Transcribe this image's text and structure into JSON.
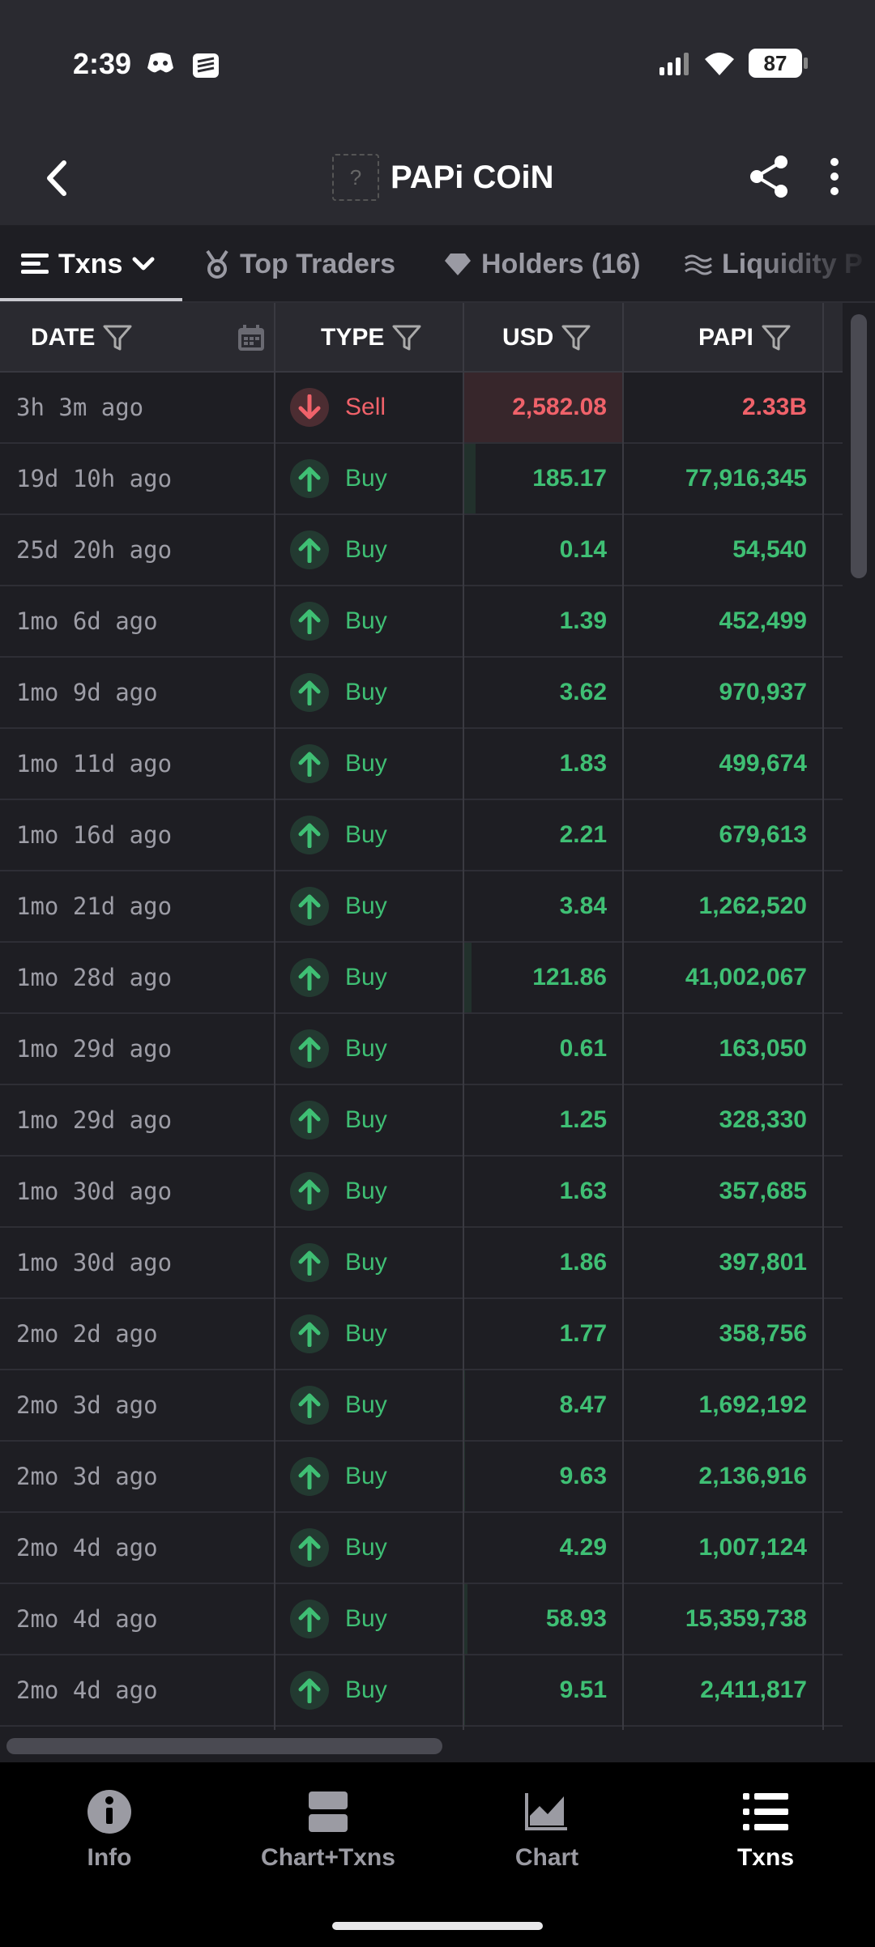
{
  "status_bar": {
    "time": "2:39",
    "battery": "87"
  },
  "header": {
    "title": "PAPi COiN",
    "logo_placeholder": "?"
  },
  "tabs": [
    {
      "label": "Txns",
      "active": true
    },
    {
      "label": "Top Traders"
    },
    {
      "label": "Holders (16)"
    },
    {
      "label": "Liquidity P"
    }
  ],
  "table": {
    "columns": {
      "date": "DATE",
      "type": "TYPE",
      "usd": "USD",
      "papi": "PAPI"
    },
    "rows": [
      {
        "date": "3h 3m ago",
        "type": "Sell",
        "usd": "2,582.08",
        "papi": "2.33B"
      },
      {
        "date": "19d 10h ago",
        "type": "Buy",
        "usd": "185.17",
        "papi": "77,916,345"
      },
      {
        "date": "25d 20h ago",
        "type": "Buy",
        "usd": "0.14",
        "papi": "54,540"
      },
      {
        "date": "1mo 6d ago",
        "type": "Buy",
        "usd": "1.39",
        "papi": "452,499"
      },
      {
        "date": "1mo 9d ago",
        "type": "Buy",
        "usd": "3.62",
        "papi": "970,937"
      },
      {
        "date": "1mo 11d ago",
        "type": "Buy",
        "usd": "1.83",
        "papi": "499,674"
      },
      {
        "date": "1mo 16d ago",
        "type": "Buy",
        "usd": "2.21",
        "papi": "679,613"
      },
      {
        "date": "1mo 21d ago",
        "type": "Buy",
        "usd": "3.84",
        "papi": "1,262,520"
      },
      {
        "date": "1mo 28d ago",
        "type": "Buy",
        "usd": "121.86",
        "papi": "41,002,067"
      },
      {
        "date": "1mo 29d ago",
        "type": "Buy",
        "usd": "0.61",
        "papi": "163,050"
      },
      {
        "date": "1mo 29d ago",
        "type": "Buy",
        "usd": "1.25",
        "papi": "328,330"
      },
      {
        "date": "1mo 30d ago",
        "type": "Buy",
        "usd": "1.63",
        "papi": "357,685"
      },
      {
        "date": "1mo 30d ago",
        "type": "Buy",
        "usd": "1.86",
        "papi": "397,801"
      },
      {
        "date": "2mo 2d ago",
        "type": "Buy",
        "usd": "1.77",
        "papi": "358,756"
      },
      {
        "date": "2mo 3d ago",
        "type": "Buy",
        "usd": "8.47",
        "papi": "1,692,192"
      },
      {
        "date": "2mo 3d ago",
        "type": "Buy",
        "usd": "9.63",
        "papi": "2,136,916"
      },
      {
        "date": "2mo 4d ago",
        "type": "Buy",
        "usd": "4.29",
        "papi": "1,007,124"
      },
      {
        "date": "2mo 4d ago",
        "type": "Buy",
        "usd": "58.93",
        "papi": "15,359,738"
      },
      {
        "date": "2mo 4d ago",
        "type": "Buy",
        "usd": "9.51",
        "papi": "2,411,817"
      }
    ]
  },
  "bottom_nav": [
    {
      "label": "Info",
      "icon": "info-icon"
    },
    {
      "label": "Chart+Txns",
      "icon": "chart-txns-icon"
    },
    {
      "label": "Chart",
      "icon": "chart-icon"
    },
    {
      "label": "Txns",
      "icon": "list-icon",
      "active": true
    }
  ],
  "colors": {
    "buy": "#3fbf74",
    "sell": "#f0626a",
    "background": "#1e1e23",
    "header": "#2a2a30"
  }
}
